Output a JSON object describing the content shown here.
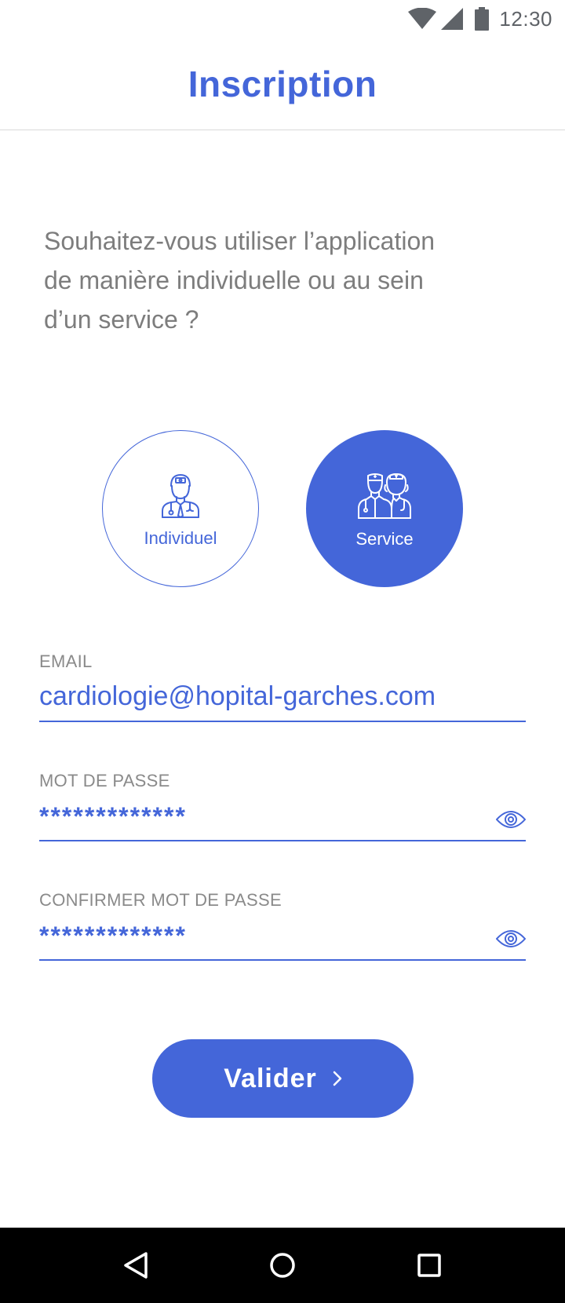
{
  "status_bar": {
    "time": "12:30",
    "icons": [
      "wifi-icon",
      "signal-icon",
      "battery-icon"
    ]
  },
  "header": {
    "title": "Inscription"
  },
  "question": "Souhaitez-vous utiliser l’application de manière individuelle ou au sein d’un service ?",
  "options": {
    "individuel": {
      "label": "Individuel",
      "icon": "doctor-icon",
      "selected": false
    },
    "service": {
      "label": "Service",
      "icon": "medical-team-icon",
      "selected": true
    }
  },
  "form": {
    "email": {
      "label": "EMAIL",
      "value": "cardiologie@hopital-garches.com"
    },
    "password": {
      "label": "MOT DE PASSE",
      "value": "*************",
      "icon": "eye-icon"
    },
    "password_confirm": {
      "label": "CONFIRMER MOT DE PASSE",
      "value": "*************",
      "icon": "eye-icon"
    }
  },
  "submit": {
    "label": "Valider",
    "icon": "chevron-right-icon"
  },
  "nav_bar": {
    "icons": [
      "back-icon",
      "home-icon",
      "recents-icon"
    ]
  },
  "colors": {
    "accent": "#4466d9",
    "label_gray": "#8a8a8a",
    "question_gray": "#7d7d7d"
  }
}
